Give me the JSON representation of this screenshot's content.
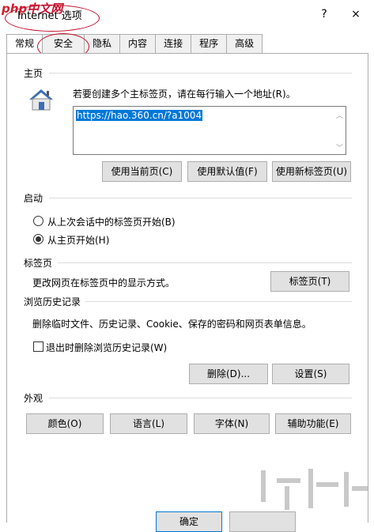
{
  "window": {
    "title": "Internet 选项",
    "help": "?",
    "close": "×",
    "logo_php": "php",
    "logo_cn": "中文网"
  },
  "tabs": [
    "常规",
    "安全",
    "隐私",
    "内容",
    "连接",
    "程序",
    "高级"
  ],
  "home": {
    "section": "主页",
    "hint": "若要创建多个主标签页，请在每行输入一个地址(R)。",
    "url": "https://hao.360.cn/?a1004",
    "btn_current": "使用当前页(C)",
    "btn_default": "使用默认值(F)",
    "btn_newtab": "使用新标签页(U)"
  },
  "startup": {
    "section": "启动",
    "option1": "从上次会话中的标签页开始(B)",
    "option2": "从主页开始(H)",
    "selected": "option2"
  },
  "tabsec": {
    "section": "标签页",
    "desc": "更改网页在标签页中的显示方式。",
    "btn": "标签页(T)"
  },
  "history": {
    "section": "浏览历史记录",
    "desc": "删除临时文件、历史记录、Cookie、保存的密码和网页表单信息。",
    "checkbox": "退出时删除浏览历史记录(W)",
    "btn_delete": "删除(D)...",
    "btn_settings": "设置(S)"
  },
  "appearance": {
    "section": "外观",
    "btn_colors": "颜色(O)",
    "btn_languages": "语言(L)",
    "btn_fonts": "字体(N)",
    "btn_access": "辅助功能(E)"
  },
  "footer": {
    "ok": "确定"
  }
}
